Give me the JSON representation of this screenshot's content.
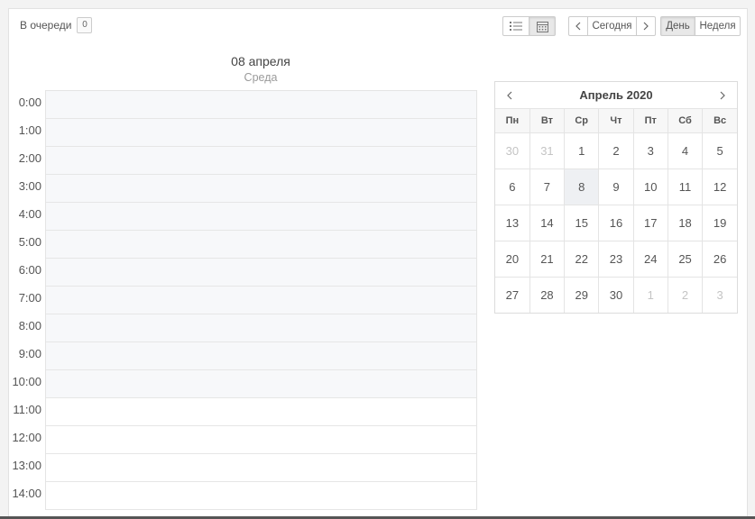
{
  "queue": {
    "label": "В очереди",
    "count": "0"
  },
  "toolbar": {
    "list_view_icon": "list-icon",
    "calendar_view_icon": "calendar-icon",
    "today_label": "Сегодня",
    "day_label": "День",
    "week_label": "Неделя",
    "active_view": "day"
  },
  "day_view": {
    "date": "08 апреля",
    "weekday": "Среда",
    "hours": [
      "0:00",
      "1:00",
      "2:00",
      "3:00",
      "4:00",
      "5:00",
      "6:00",
      "7:00",
      "8:00",
      "9:00",
      "10:00",
      "11:00",
      "12:00",
      "13:00",
      "14:00"
    ]
  },
  "mini_calendar": {
    "title": "Апрель 2020",
    "weekdays": [
      "Пн",
      "Вт",
      "Ср",
      "Чт",
      "Пт",
      "Сб",
      "Вс"
    ],
    "weeks": [
      [
        {
          "d": "30",
          "other": true
        },
        {
          "d": "31",
          "other": true
        },
        {
          "d": "1"
        },
        {
          "d": "2"
        },
        {
          "d": "3"
        },
        {
          "d": "4"
        },
        {
          "d": "5"
        }
      ],
      [
        {
          "d": "6"
        },
        {
          "d": "7"
        },
        {
          "d": "8",
          "selected": true
        },
        {
          "d": "9"
        },
        {
          "d": "10"
        },
        {
          "d": "11"
        },
        {
          "d": "12"
        }
      ],
      [
        {
          "d": "13"
        },
        {
          "d": "14"
        },
        {
          "d": "15"
        },
        {
          "d": "16"
        },
        {
          "d": "17"
        },
        {
          "d": "18"
        },
        {
          "d": "19"
        }
      ],
      [
        {
          "d": "20"
        },
        {
          "d": "21"
        },
        {
          "d": "22"
        },
        {
          "d": "23"
        },
        {
          "d": "24"
        },
        {
          "d": "25"
        },
        {
          "d": "26"
        }
      ],
      [
        {
          "d": "27"
        },
        {
          "d": "28"
        },
        {
          "d": "29"
        },
        {
          "d": "30"
        },
        {
          "d": "1",
          "other": true
        },
        {
          "d": "2",
          "other": true
        },
        {
          "d": "3",
          "other": true
        }
      ]
    ]
  },
  "colors": {
    "off_hours_bg": "#f7f8fa",
    "selected_day_bg": "#eef0f3"
  }
}
